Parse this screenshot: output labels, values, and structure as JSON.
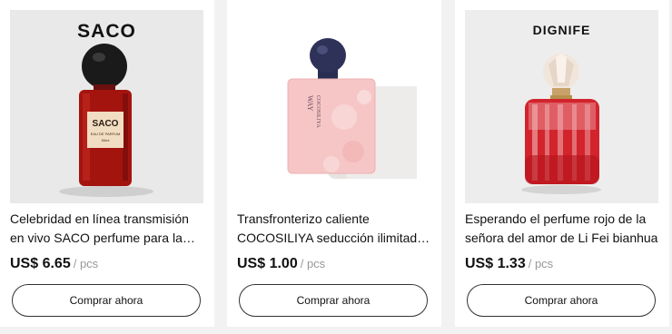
{
  "products": [
    {
      "brand_text": "SACO",
      "label_brand": "SACO",
      "label_sub": "EAU DE PARFUM",
      "label_size": "50ml",
      "title": "Celebridad en línea transmisión en vivo SACO perfume para la dama",
      "price": "US$ 6.65",
      "unit": "/ pcs",
      "button": "Comprar ahora"
    },
    {
      "label_brand": "COCOSILIYA",
      "label_script": "WAY",
      "title": "Transfronterizo caliente COCOSILIYA seducción ilimitada perfume",
      "price": "US$ 1.00",
      "unit": "/ pcs",
      "button": "Comprar ahora"
    },
    {
      "brand_text": "DIGNIFE",
      "title": "Esperando el perfume rojo de la señora del amor de Li Fei bianhua",
      "price": "US$ 1.33",
      "unit": "/ pcs",
      "button": "Comprar ahora"
    }
  ],
  "colors": {
    "page_bg": "#f2f2f2",
    "card_bg": "#ffffff",
    "price": "#111111",
    "unit": "#999999"
  }
}
